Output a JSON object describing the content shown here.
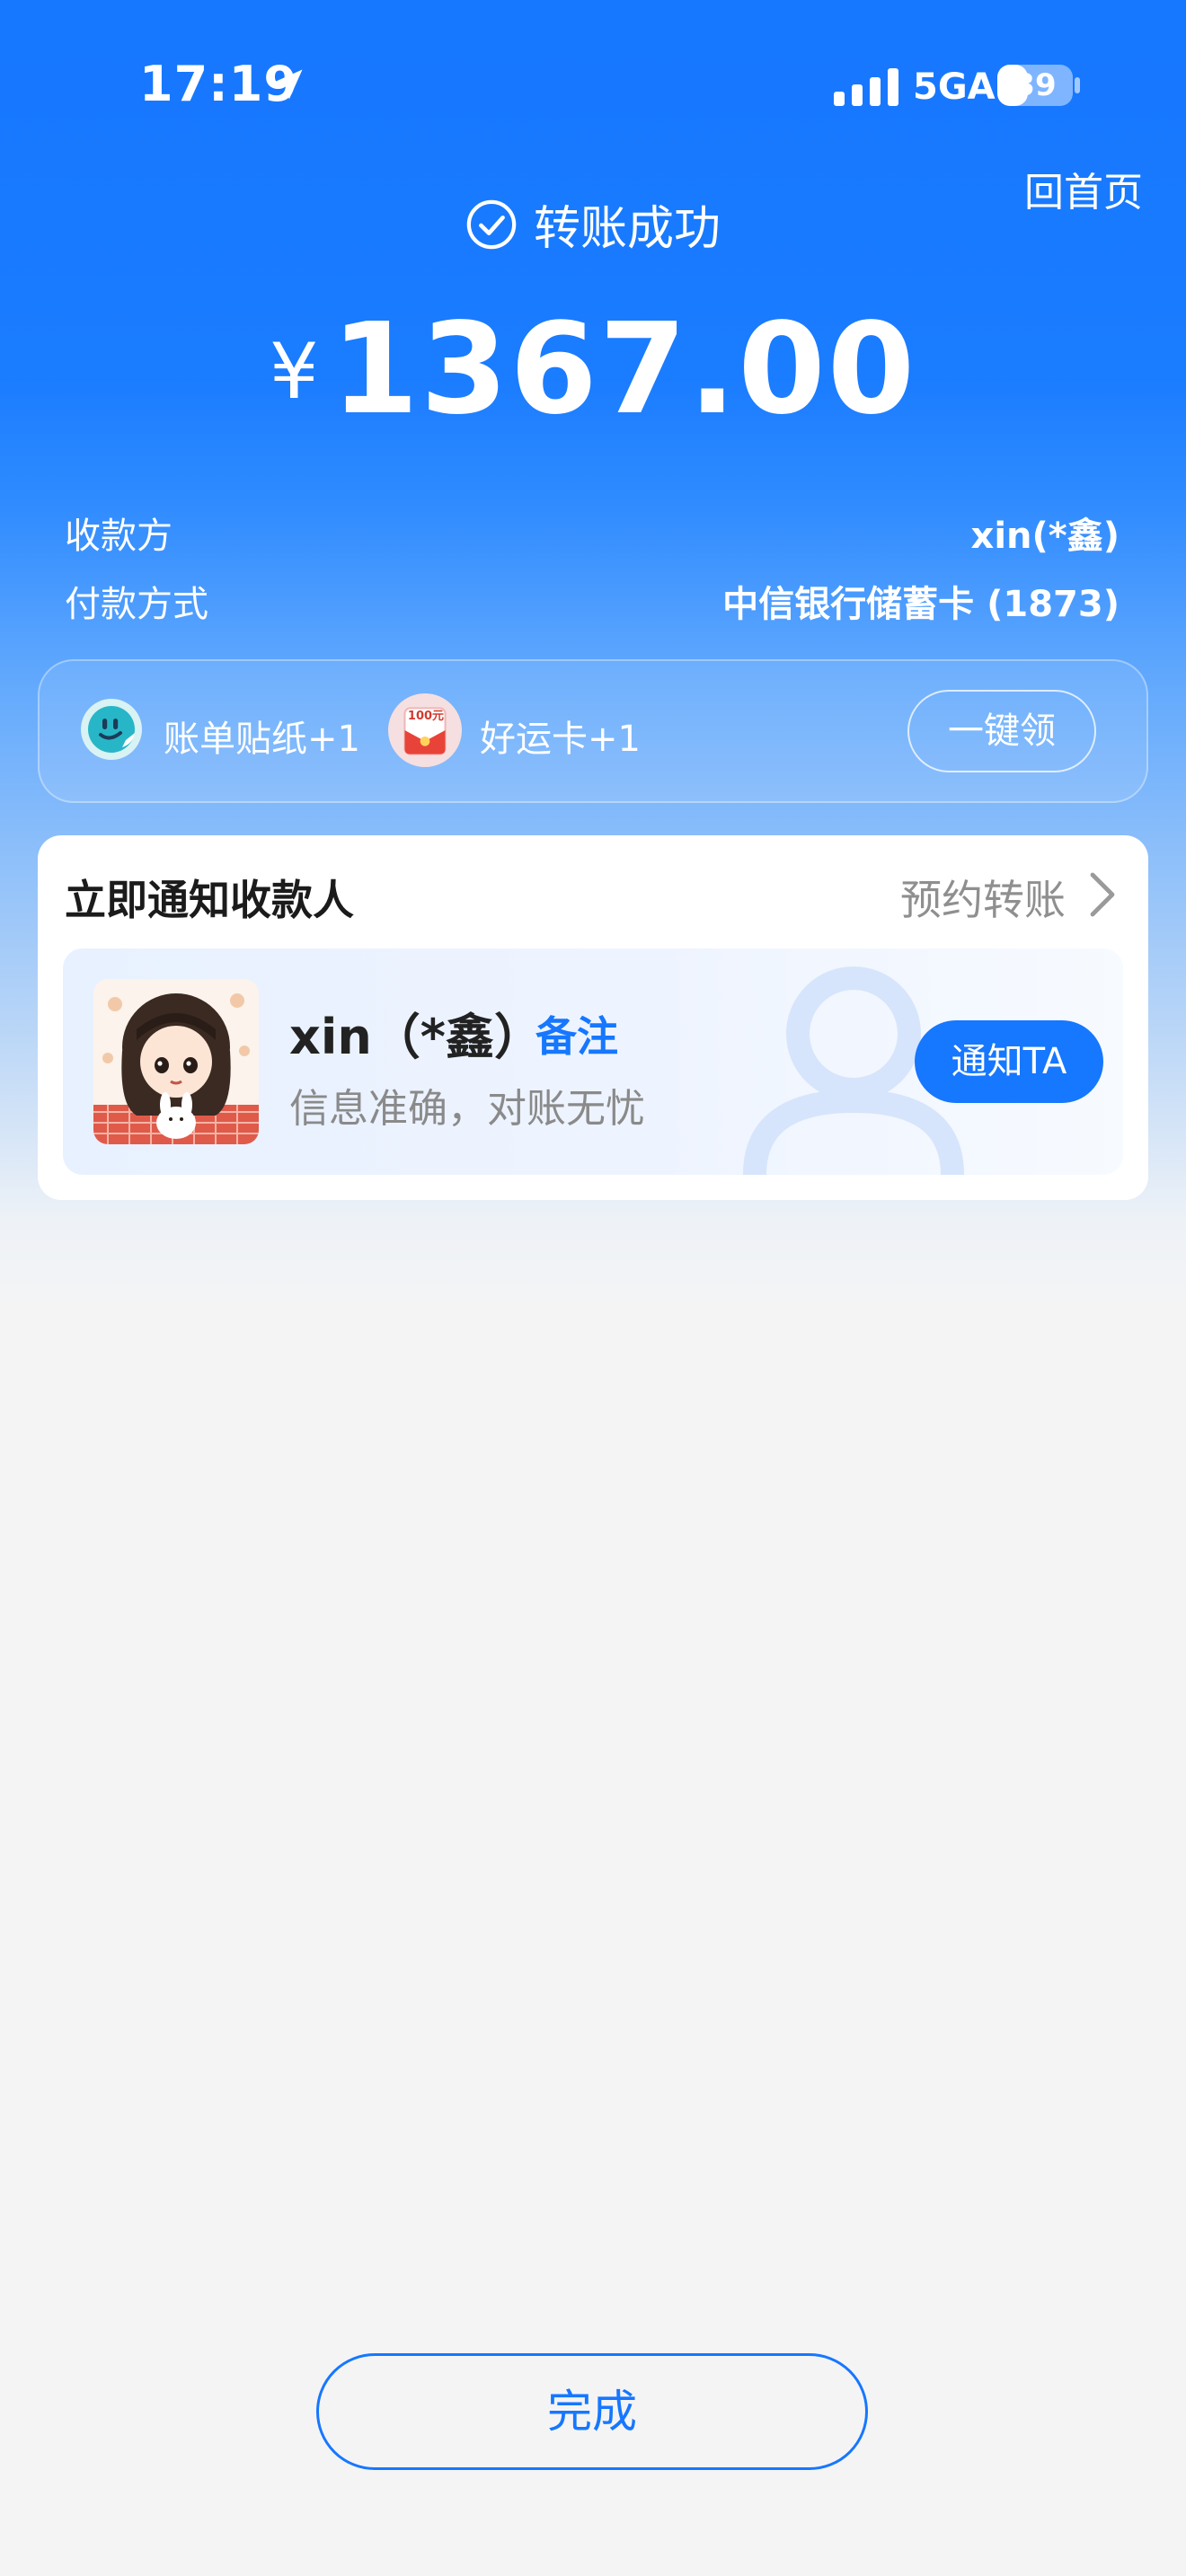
{
  "status_bar": {
    "time": "17:19",
    "network": "5GA",
    "battery": "39"
  },
  "header": {
    "home_link": "回首页",
    "status_text": "转账成功",
    "currency_symbol": "¥",
    "amount": "1367.00"
  },
  "details": [
    {
      "label": "收款方",
      "value": "xin(*鑫)"
    },
    {
      "label": "付款方式",
      "value": "中信银行储蓄卡 (1873)"
    }
  ],
  "rewards": {
    "sticker_label": "账单贴纸+1",
    "lucky_card_label": "好运卡+1",
    "lucky_card_badge": "100元",
    "claim_label": "一键领"
  },
  "notify": {
    "title": "立即通知收款人",
    "schedule_label": "预约转账",
    "payee_name": "xin（*鑫）",
    "remark_label": "备注",
    "subtext": "信息准确，对账无忧",
    "notify_button": "通知TA"
  },
  "done_label": "完成",
  "colors": {
    "accent": "#1677ff",
    "background": "#f4f4f5"
  }
}
